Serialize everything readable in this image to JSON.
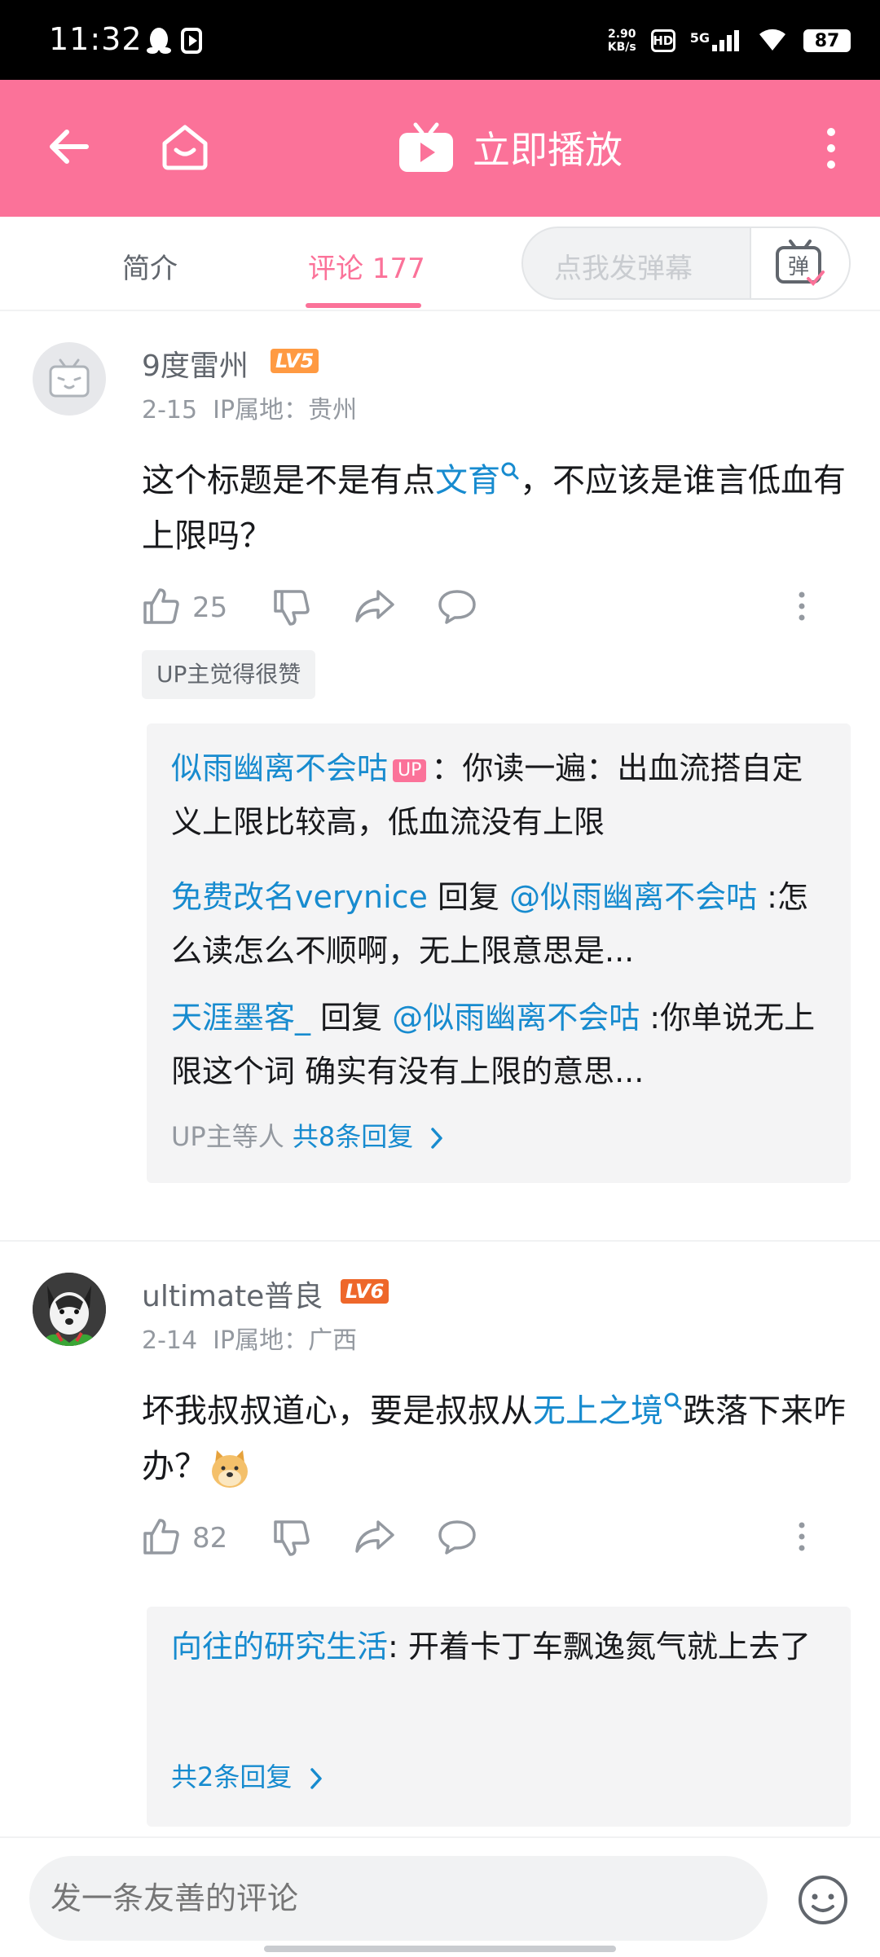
{
  "status_bar": {
    "time": "11:32",
    "net_speed_value": "2.90",
    "net_speed_unit": "KB/s",
    "hd": "HD",
    "signal": "5G",
    "battery": "87"
  },
  "app_bar": {
    "play_label": "立即播放",
    "accent_color": "#fb7299"
  },
  "tabs": {
    "intro": "简介",
    "comments": "评论 177"
  },
  "danmaku": {
    "placeholder": "点我发弹幕",
    "button_label": "弹"
  },
  "comments": [
    {
      "username": "9度雷州",
      "level": "LV5",
      "date": "2-15",
      "ip_label": "IP属地：",
      "ip": "贵州",
      "content_before": "这个标题是不是有点",
      "content_link": "文育",
      "content_after": "，不应该是谁言低血有上限吗？",
      "likes": "25",
      "tag": "UP主觉得很赞",
      "replies": [
        {
          "user": "似雨幽离不会咕",
          "badge": "UP",
          "text": "：你读一遍：出血流搭自定义上限比较高，低血流没有上限"
        },
        {
          "user": "免费改名verynice",
          "reply_word": " 回复 ",
          "target": "@似雨幽离不会咕",
          "text": " :怎么读怎么不顺啊，无上限意思是..."
        },
        {
          "user": "天涯墨客_",
          "reply_word": " 回复 ",
          "target": "@似雨幽离不会咕",
          "text": " :你单说无上限这个词 确实有没有上限的意思..."
        }
      ],
      "more_prefix": "UP主等人 ",
      "more_link": "共8条回复"
    },
    {
      "username": "ultimate普良",
      "level": "LV6",
      "date": "2-14",
      "ip_label": "IP属地：",
      "ip": "广西",
      "content_before": "坏我叔叔道心，要是叔叔从",
      "content_link": "无上之境",
      "content_after": "跌落下来咋办？",
      "likes": "82",
      "replies": [
        {
          "user": "向往的研究生活",
          "text": ": 开着卡丁车飘逸氮气就上去了"
        }
      ],
      "more_link": "共2条回复"
    }
  ],
  "bottom": {
    "placeholder": "发一条友善的评论"
  },
  "icons": {
    "back": "back-arrow-icon",
    "home": "home-icon",
    "tv": "tv-play-icon",
    "more": "more-vertical-icon",
    "like": "thumb-up-icon",
    "dislike": "thumb-down-icon",
    "share": "share-icon",
    "comment": "comment-icon",
    "emoji": "emoji-icon"
  }
}
